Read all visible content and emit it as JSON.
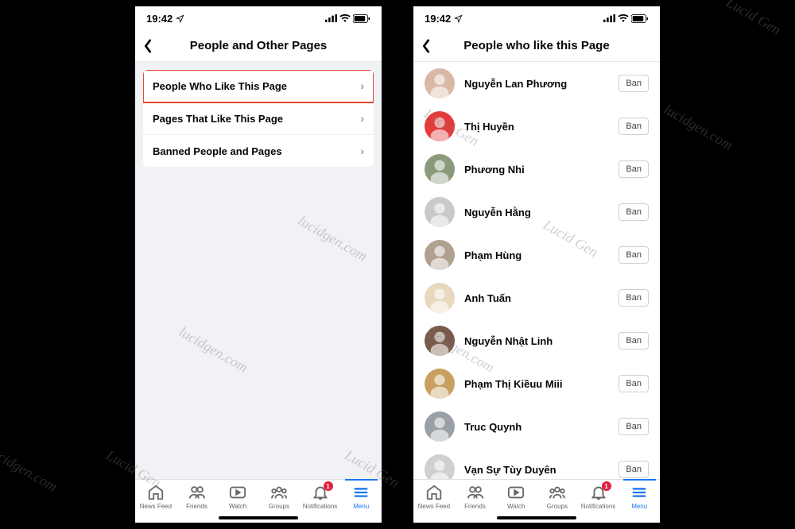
{
  "status": {
    "time": "19:42",
    "location_icon": "location-arrow",
    "signal_icon": "signal",
    "wifi_icon": "wifi",
    "battery_icon": "battery"
  },
  "screen1": {
    "title": "People and Other Pages",
    "options": [
      {
        "label": "People Who Like This Page",
        "highlighted": true
      },
      {
        "label": "Pages That Like This Page",
        "highlighted": false
      },
      {
        "label": "Banned People and Pages",
        "highlighted": false
      }
    ]
  },
  "screen2": {
    "title": "People who like this Page",
    "ban_label": "Ban",
    "people": [
      {
        "name": "Nguyễn Lan Phương",
        "avatar_color": "#d9b8a8"
      },
      {
        "name": "Thị Huyền",
        "avatar_color": "#e23b3b"
      },
      {
        "name": "Phương Nhi",
        "avatar_color": "#8a9a7a"
      },
      {
        "name": "Nguyễn Hằng",
        "avatar_color": "#c9c9c9"
      },
      {
        "name": "Phạm Hùng",
        "avatar_color": "#b0a090"
      },
      {
        "name": "Anh Tuấn",
        "avatar_color": "#e8d8c0"
      },
      {
        "name": "Nguyễn Nhật Linh",
        "avatar_color": "#7a5a4a"
      },
      {
        "name": "Phạm Thị Kiềuu Miii",
        "avatar_color": "#c9a060"
      },
      {
        "name": "Truc Quynh",
        "avatar_color": "#9aa0a6"
      },
      {
        "name": "Vạn Sự Tùy Duyên",
        "avatar_color": "#d0d0d0"
      }
    ]
  },
  "bottom_nav": {
    "tabs": [
      {
        "label": "News Feed",
        "icon": "home"
      },
      {
        "label": "Friends",
        "icon": "friends"
      },
      {
        "label": "Watch",
        "icon": "watch"
      },
      {
        "label": "Groups",
        "icon": "groups"
      },
      {
        "label": "Notifications",
        "icon": "bell",
        "badge": "1"
      },
      {
        "label": "Menu",
        "icon": "menu",
        "active": true
      }
    ]
  },
  "watermark_text": "lucidgen.com",
  "watermark_brand": "Lucid Gen"
}
